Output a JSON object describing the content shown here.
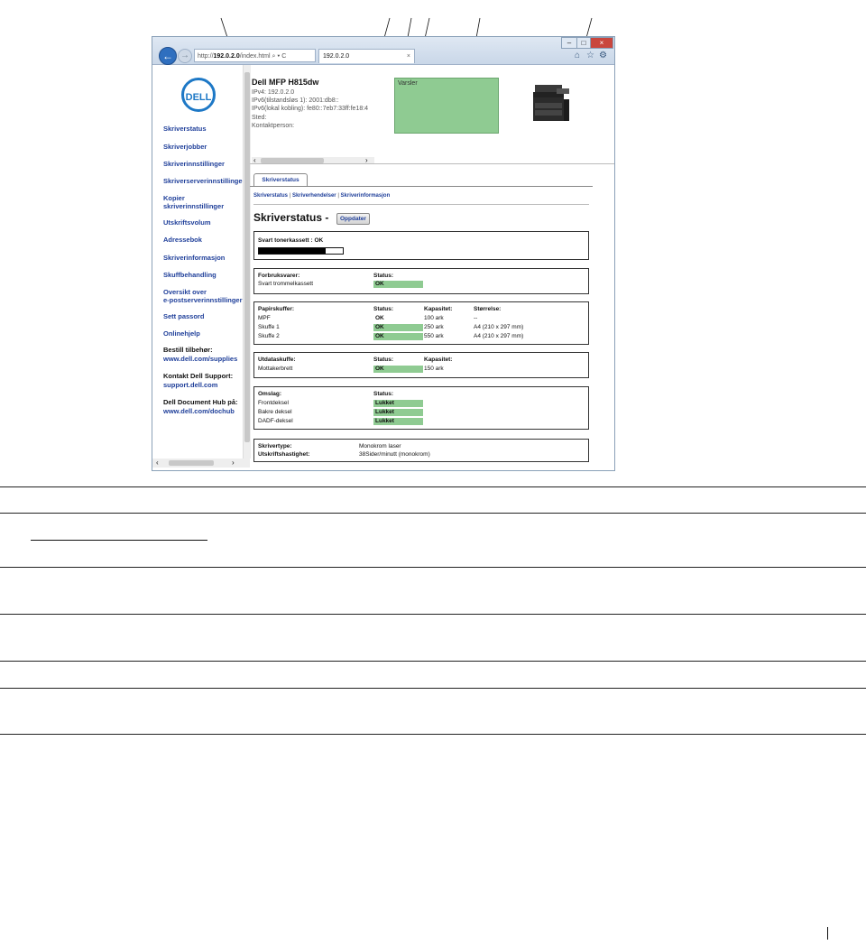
{
  "browser": {
    "address": "http://192.0.2.0/index.html",
    "address_host": "192.0.2.0",
    "address_prefix": "http://",
    "address_suffix": "/index.html",
    "address_controls": "⌕ ▾ C",
    "tab_title": "192.0.2.0",
    "tab_close": "×"
  },
  "header": {
    "printer_name": "Dell MFP H815dw",
    "ipv4": "IPv4: 192.0.2.0",
    "ipv6_stateless": "IPv6(tilstandsløs 1): 2001:db8::",
    "ipv6_link_local": "IPv6(lokal kobling): fe80::7eb7:33ff:fe18:4",
    "location": "Sted:",
    "contact": "Kontaktperson:",
    "alert_label": "Varsler"
  },
  "leftnav": {
    "logo": "DELL",
    "items": [
      {
        "label": "Skriverstatus"
      },
      {
        "label": "Skriverjobber"
      },
      {
        "label": "Skriverinnstillinger"
      },
      {
        "label": "Skriverserverinnstillinger"
      },
      {
        "label": "Kopier\nskriverinnstillinger"
      },
      {
        "label": "Utskriftsvolum"
      },
      {
        "label": "Adressebok"
      },
      {
        "label": "Skriverinformasjon"
      },
      {
        "label": "Skuffbehandling"
      },
      {
        "label": "Oversikt over\ne-postserverinnstillinger"
      },
      {
        "label": "Sett passord"
      },
      {
        "label": "Onlinehjelp"
      }
    ],
    "supplies_label": "Bestill tilbehør:",
    "supplies_link": "www.dell.com/supplies",
    "support_label": "Kontakt Dell Support:",
    "support_link": "support.dell.com",
    "dochub_label": "Dell Document Hub på:",
    "dochub_link": "www.dell.com/dochub"
  },
  "status": {
    "tab": "Skriverstatus",
    "sublinks": [
      "Skriverstatus",
      "Skriverhendelser",
      "Skriverinformasjon"
    ],
    "sublink_sep": "|",
    "title": "Skriverstatus -",
    "refresh": "Oppdater",
    "toner_label": "Svart tonerkassett : OK",
    "toner_level": 0.8,
    "consumables": {
      "h1": "Forbruksvarer:",
      "h2": "Status:",
      "r1": "Svart trommelkassett",
      "r1s": "OK"
    },
    "trays": {
      "h1": "Papirskuffer:",
      "h2": "Status:",
      "h3": "Kapasitet:",
      "h4": "Størrelse:",
      "rows": [
        {
          "name": "MPF",
          "status": "OK",
          "cap": "100 ark",
          "size": "--"
        },
        {
          "name": "Skuffe 1",
          "status": "OK",
          "cap": "250 ark",
          "size": "A4 (210 x 297 mm)"
        },
        {
          "name": "Skuffe 2",
          "status": "OK",
          "cap": "550 ark",
          "size": "A4 (210 x 297 mm)"
        }
      ]
    },
    "output": {
      "h1": "Utdataskuffe:",
      "h2": "Status:",
      "h3": "Kapasitet:",
      "name": "Mottakerbrett",
      "status": "OK",
      "cap": "150 ark"
    },
    "covers": {
      "h1": "Omslag:",
      "h2": "Status:",
      "rows": [
        {
          "name": "Frontdeksel",
          "status": "Lukket"
        },
        {
          "name": "Bakre deksel",
          "status": "Lukket"
        },
        {
          "name": "DADF-deksel",
          "status": "Lukket"
        }
      ]
    },
    "info": {
      "type_label": "Skrivertype:",
      "type_value": "Monokrom laser",
      "speed_label": "Utskriftshastighet:",
      "speed_value": "38Sider/minutt (monokrom)"
    }
  }
}
